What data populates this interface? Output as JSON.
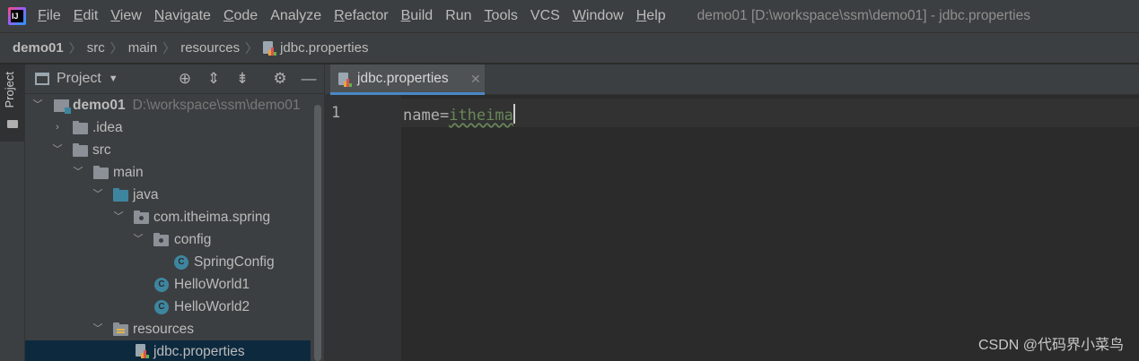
{
  "menubar": {
    "items": [
      {
        "mnemonic": "F",
        "rest": "ile"
      },
      {
        "mnemonic": "E",
        "rest": "dit"
      },
      {
        "mnemonic": "V",
        "rest": "iew"
      },
      {
        "mnemonic": "N",
        "rest": "avigate"
      },
      {
        "mnemonic": "C",
        "rest": "ode"
      },
      {
        "mnemonic": "",
        "rest": "Analyze"
      },
      {
        "mnemonic": "R",
        "rest": "efactor"
      },
      {
        "mnemonic": "B",
        "rest": "uild"
      },
      {
        "mnemonic": "",
        "rest": "Run"
      },
      {
        "mnemonic": "T",
        "rest": "ools"
      },
      {
        "mnemonic": "",
        "rest": "VCS"
      },
      {
        "mnemonic": "W",
        "rest": "indow"
      },
      {
        "mnemonic": "H",
        "rest": "elp"
      }
    ],
    "window_title": "demo01 [D:\\workspace\\ssm\\demo01] - jdbc.properties"
  },
  "breadcrumb": {
    "items": [
      "demo01",
      "src",
      "main",
      "resources",
      "jdbc.properties"
    ]
  },
  "tool_strip": {
    "project_tab_label": "Project"
  },
  "project_panel": {
    "view_label": "Project",
    "tree": [
      {
        "label": "demo01",
        "path": "D:\\workspace\\ssm\\demo01"
      },
      {
        "label": ".idea"
      },
      {
        "label": "src"
      },
      {
        "label": "main"
      },
      {
        "label": "java"
      },
      {
        "label": "com.itheima.spring"
      },
      {
        "label": "config"
      },
      {
        "label": "SpringConfig"
      },
      {
        "label": "HelloWorld1"
      },
      {
        "label": "HelloWorld2"
      },
      {
        "label": "resources"
      },
      {
        "label": "jdbc.properties"
      }
    ]
  },
  "editor": {
    "tab_label": "jdbc.properties",
    "line_number": "1",
    "code_key": "name",
    "code_eq": "=",
    "code_value": "itheima"
  },
  "watermark": "CSDN @代码界小菜鸟",
  "colors": {
    "accent": "#4a88c7",
    "selection": "#0d293e",
    "string": "#6a8759",
    "folder_blue": "#3e86a0"
  },
  "icons": [
    "app-logo-icon",
    "project-view-icon",
    "locate-icon",
    "expand-all-icon",
    "collapse-all-icon",
    "gear-icon",
    "minimize-icon",
    "folder-icon",
    "package-icon",
    "class-icon",
    "properties-file-icon",
    "close-icon"
  ]
}
